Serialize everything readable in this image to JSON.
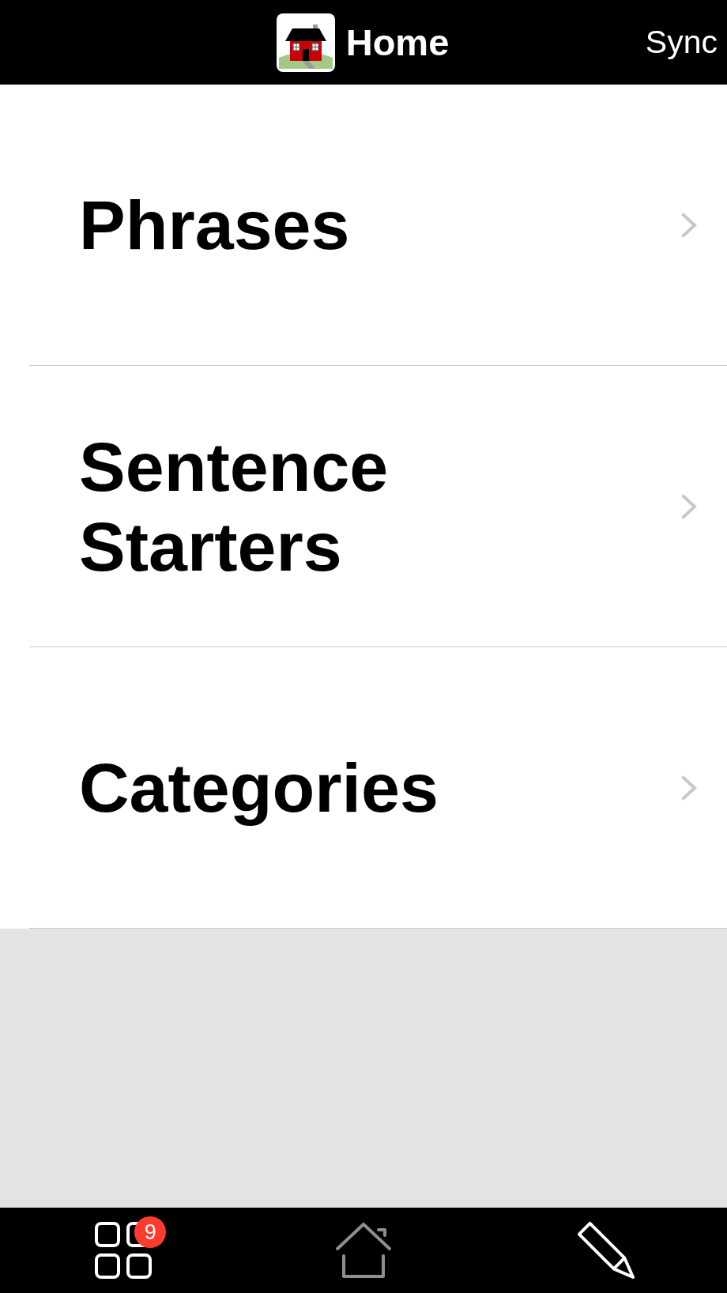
{
  "header": {
    "title": "Home",
    "action": "Sync"
  },
  "menu": [
    {
      "label": "Phrases"
    },
    {
      "label": "Sentence Starters"
    },
    {
      "label": "Categories"
    }
  ],
  "tab_bar": [
    {
      "kind": "grid",
      "badge": "9",
      "disabled": false
    },
    {
      "kind": "home",
      "disabled": true
    },
    {
      "kind": "pencil",
      "disabled": false
    }
  ]
}
